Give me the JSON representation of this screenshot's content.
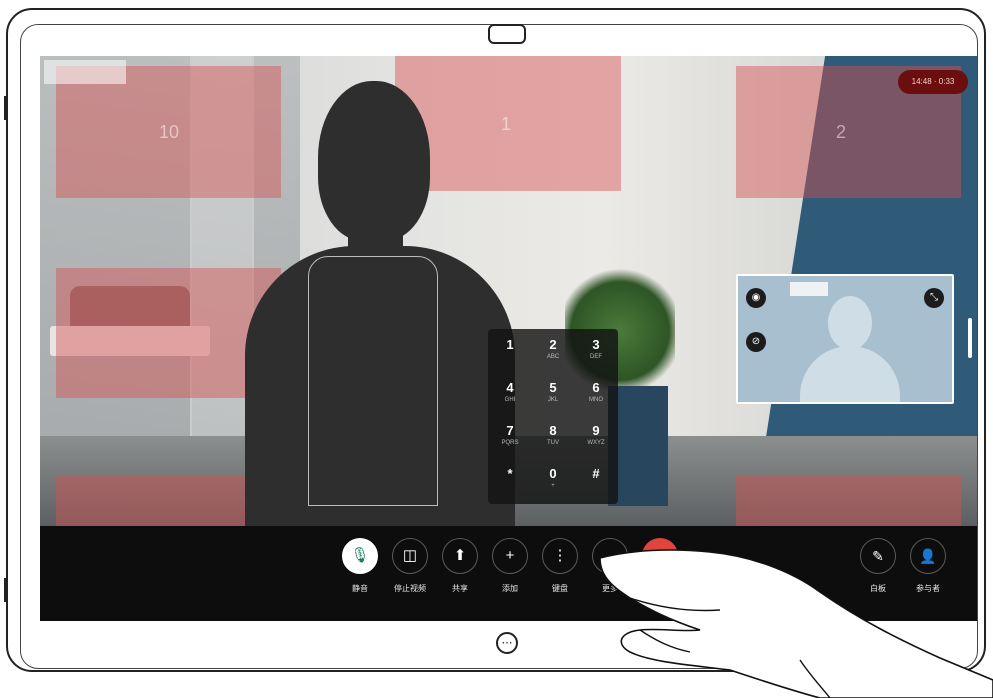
{
  "top_overlay": {
    "timer": "14:48 · 0:33"
  },
  "zones": [
    {
      "number": "10"
    },
    {
      "number": "1"
    },
    {
      "number": "2"
    }
  ],
  "keypad": {
    "keys": [
      {
        "digit": "1",
        "letters": ""
      },
      {
        "digit": "2",
        "letters": "ABC"
      },
      {
        "digit": "3",
        "letters": "DEF"
      },
      {
        "digit": "4",
        "letters": "GHI"
      },
      {
        "digit": "5",
        "letters": "JKL"
      },
      {
        "digit": "6",
        "letters": "MNO"
      },
      {
        "digit": "7",
        "letters": "PQRS"
      },
      {
        "digit": "8",
        "letters": "TUV"
      },
      {
        "digit": "9",
        "letters": "WXYZ"
      },
      {
        "digit": "*",
        "letters": ""
      },
      {
        "digit": "0",
        "letters": "+"
      },
      {
        "digit": "#",
        "letters": ""
      }
    ]
  },
  "self_view": {
    "icons": [
      "self-view-menu-icon",
      "mute-self-view-icon",
      "minimize-icon"
    ]
  },
  "controls": [
    {
      "name": "mute",
      "icon": "microphone-icon",
      "label": "静音",
      "glyph": "🎙",
      "state": "active"
    },
    {
      "name": "stop-video",
      "icon": "video-camera-icon",
      "label": "停止视频",
      "glyph": "◫",
      "state": "normal"
    },
    {
      "name": "share",
      "icon": "share-icon",
      "label": "共享",
      "glyph": "⬆",
      "state": "normal"
    },
    {
      "name": "add",
      "icon": "plus-icon",
      "label": "添加",
      "glyph": "+",
      "state": "normal"
    },
    {
      "name": "keypad",
      "icon": "keypad-icon",
      "label": "键盘",
      "glyph": "⋮",
      "state": "normal"
    },
    {
      "name": "more",
      "icon": "more-icon",
      "label": "更多",
      "glyph": "…",
      "state": "normal"
    },
    {
      "name": "end-call",
      "icon": "end-call-icon",
      "label": "",
      "glyph": "✕",
      "state": "end"
    }
  ],
  "right_controls": [
    {
      "name": "annotate",
      "icon": "pen-icon",
      "label": "白板",
      "glyph": "✎"
    },
    {
      "name": "participants",
      "icon": "person-icon",
      "label": "参与者",
      "glyph": "👤"
    }
  ],
  "home_icon": "grid-home-icon"
}
